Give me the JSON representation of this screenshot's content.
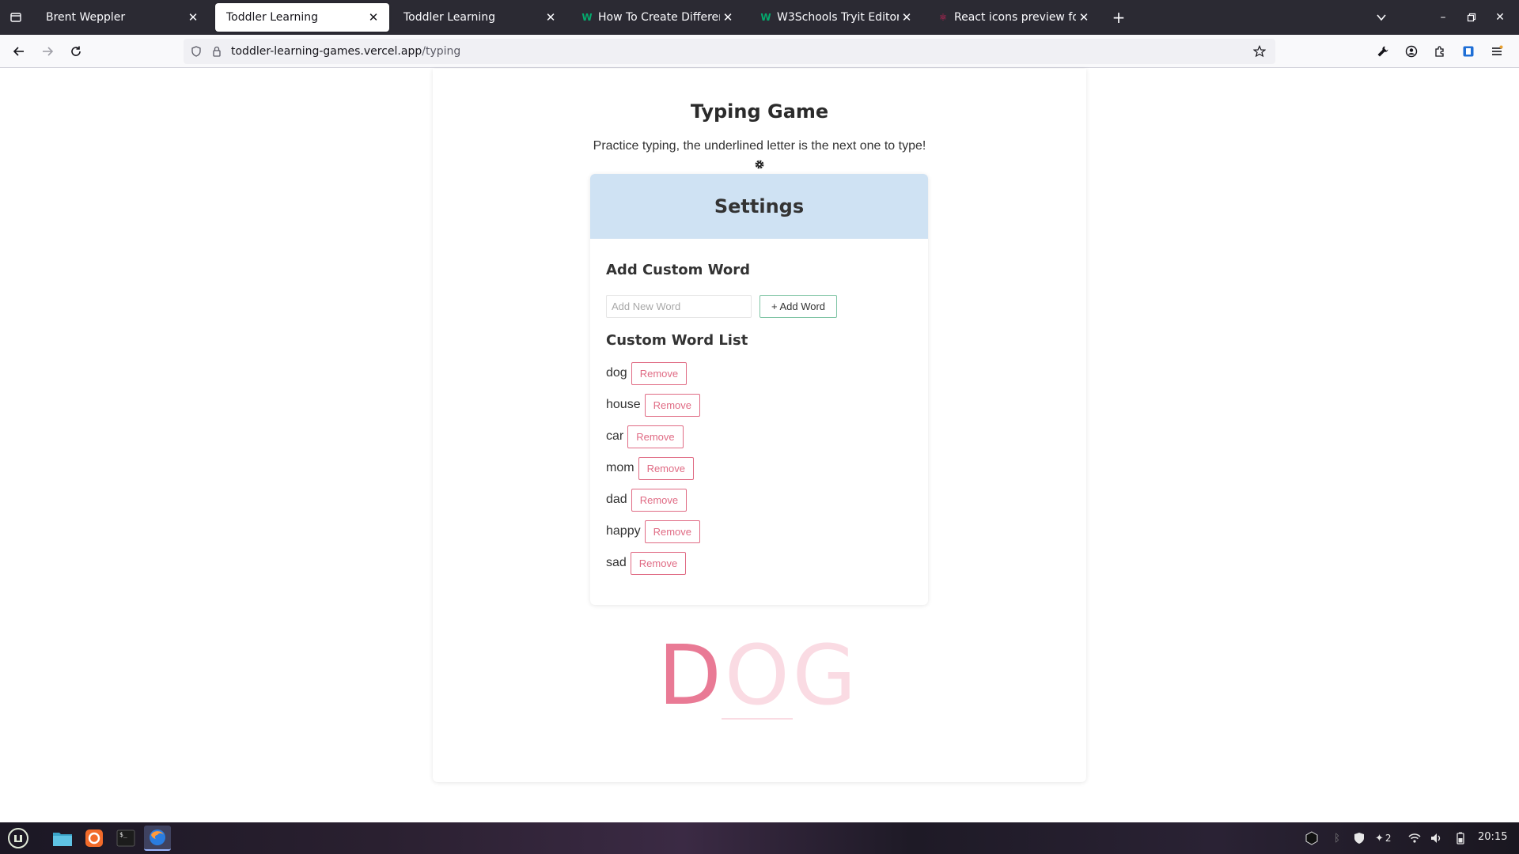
{
  "browser": {
    "tabs": [
      {
        "title": "Brent Weppler",
        "active": false,
        "favicon": ""
      },
      {
        "title": "Toddler Learning",
        "active": true,
        "favicon": ""
      },
      {
        "title": "Toddler Learning",
        "active": false,
        "favicon": ""
      },
      {
        "title": "How To Create Different Sh",
        "active": false,
        "favicon": "w3schools-icon"
      },
      {
        "title": "W3Schools Tryit Editor",
        "active": false,
        "favicon": "w3schools-icon"
      },
      {
        "title": "React icons preview for fa",
        "active": false,
        "favicon": "react-icon"
      }
    ],
    "url_host": "toddler-learning-games.vercel.app",
    "url_path": "/typing"
  },
  "page": {
    "title": "Typing Game",
    "subtitle": "Practice typing, the underlined letter is the next one to type!"
  },
  "settings": {
    "header": "Settings",
    "add_section_title": "Add Custom Word",
    "input_placeholder": "Add New Word",
    "input_value": "",
    "add_button_label": "+ Add Word",
    "list_title": "Custom Word List",
    "words": [
      "dog",
      "house",
      "car",
      "mom",
      "dad",
      "happy",
      "sad"
    ],
    "remove_label": "Remove"
  },
  "game": {
    "letters": [
      "D",
      "O",
      "G"
    ],
    "typed_count": 1,
    "colors": {
      "typed": "#e97a95",
      "pending": "#fadbe3"
    }
  },
  "taskbar": {
    "clock": "20:15",
    "network_count": "2"
  }
}
